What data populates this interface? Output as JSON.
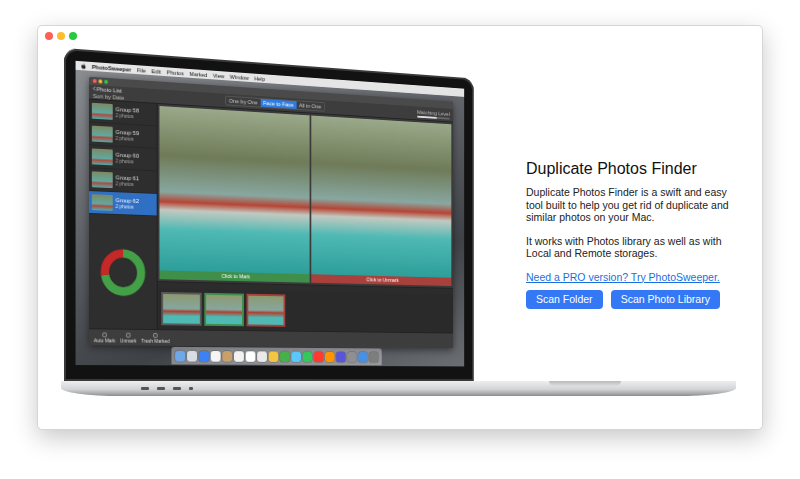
{
  "laptop_screen": {
    "menu_bar": {
      "app": "PhotoSweeper",
      "items": [
        "File",
        "Edit",
        "Photos",
        "Marked",
        "View",
        "Window",
        "Help"
      ]
    },
    "toolbar": {
      "back": "Photo List",
      "sort": "Sort by Date",
      "modes": [
        {
          "label": "One by One",
          "selected": false
        },
        {
          "label": "Face to Face",
          "selected": true
        },
        {
          "label": "All in One",
          "selected": false
        }
      ],
      "slider_label": "Matching Level",
      "level": 0.6
    },
    "groups": [
      {
        "label": "Group 58",
        "count": "2 photos",
        "selected": false
      },
      {
        "label": "Group 59",
        "count": "2 photos",
        "selected": false
      },
      {
        "label": "Group 60",
        "count": "2 photos",
        "selected": false
      },
      {
        "label": "Group 61",
        "count": "2 photos",
        "selected": false
      },
      {
        "label": "Group 62",
        "count": "2 photos",
        "selected": true
      }
    ],
    "chart": {
      "segments": [
        {
          "value": 72,
          "color": "#43a047"
        },
        {
          "value": 28,
          "color": "#c62828"
        }
      ]
    },
    "photos": [
      {
        "caption": "Click to Mark",
        "color": "#3f8f4a"
      },
      {
        "caption": "Click to Unmark",
        "color": "#a8403c"
      }
    ],
    "film_strip": [
      {
        "color": "#5a5a5a"
      },
      {
        "color": "#3f8f4a"
      },
      {
        "color": "#a8403c"
      }
    ],
    "actions": [
      "Auto Mark",
      "Unmark",
      "Trash Marked"
    ]
  },
  "info": {
    "title": "Duplicate Photos Finder",
    "paragraphs": [
      "Duplicate Photos Finder is a swift and easy tool built to help you get rid of duplicate and similar photos on your Mac.",
      "It works with Photos library as well as with Local and Remote storages."
    ],
    "link": "Need a PRO version? Try PhotoSweeper.",
    "buttons": [
      "Scan Folder",
      "Scan Photo Library"
    ]
  }
}
